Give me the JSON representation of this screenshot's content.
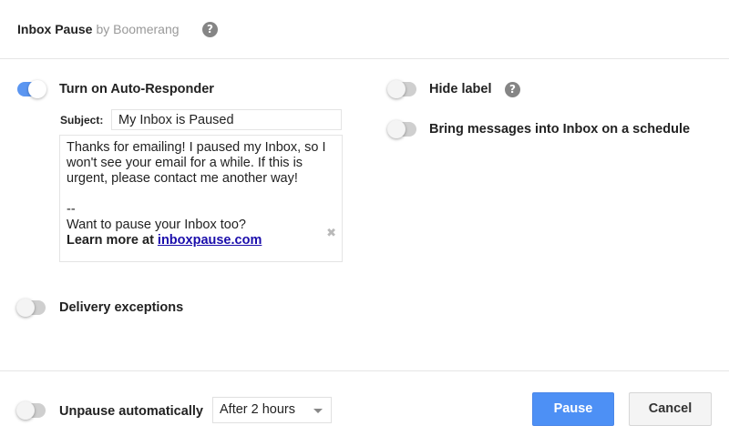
{
  "header": {
    "brand": "Inbox Pause",
    "by_text": "by Boomerang",
    "help_icon": "?"
  },
  "auto_responder": {
    "label": "Turn on Auto-Responder",
    "enabled": true,
    "subject_label": "Subject:",
    "subject_value": "My Inbox is Paused",
    "body_line1": "Thanks for emailing! I paused my Inbox, so I",
    "body_line2": "won't see your email for a while. If this is",
    "body_line3": "urgent, please contact me another way!",
    "signature_sep": "--",
    "signature_line1": "Want to pause your Inbox too?",
    "signature_learn_prefix": "Learn more at ",
    "signature_link": "inboxpause.com",
    "remove_icon": "✖"
  },
  "options": {
    "hide_label": "Hide label",
    "hide_label_help": "?",
    "hide_label_enabled": false,
    "schedule_label": "Bring messages into Inbox on a schedule",
    "schedule_enabled": false,
    "delivery_label": "Delivery exceptions",
    "delivery_enabled": false
  },
  "footer": {
    "unpause_label": "Unpause automatically",
    "unpause_enabled": false,
    "unpause_select_value": "After 2 hours",
    "pause_button": "Pause",
    "cancel_button": "Cancel"
  },
  "colors": {
    "toggle_on": "#5b96f1",
    "toggle_off": "#cfcfcf",
    "primary_button": "#4d90f5",
    "link": "#1a0dab"
  }
}
